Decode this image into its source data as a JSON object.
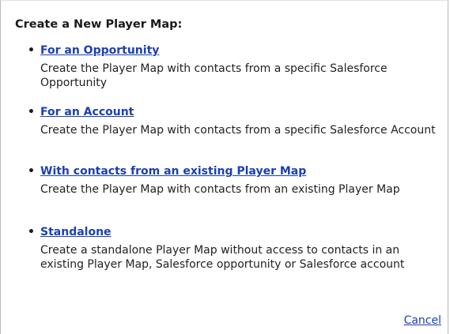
{
  "dialog": {
    "title": "Create a New Player Map:",
    "options": [
      {
        "link": "For an Opportunity",
        "description": "Create the Player Map with contacts from a specific Salesforce Opportunity"
      },
      {
        "link": "For an Account",
        "description": "Create the Player Map with contacts from a specific Salesforce Account"
      },
      {
        "link": "With contacts from an existing Player Map",
        "description": "Create the Player Map with contacts from an existing Player Map"
      },
      {
        "link": "Standalone",
        "description": "Create a standalone Player Map without access to contacts in an existing Player Map, Salesforce opportunity or Salesforce account"
      }
    ],
    "bullet": "•",
    "cancel_label": "Cancel",
    "link_color": "#1b3fb5"
  }
}
